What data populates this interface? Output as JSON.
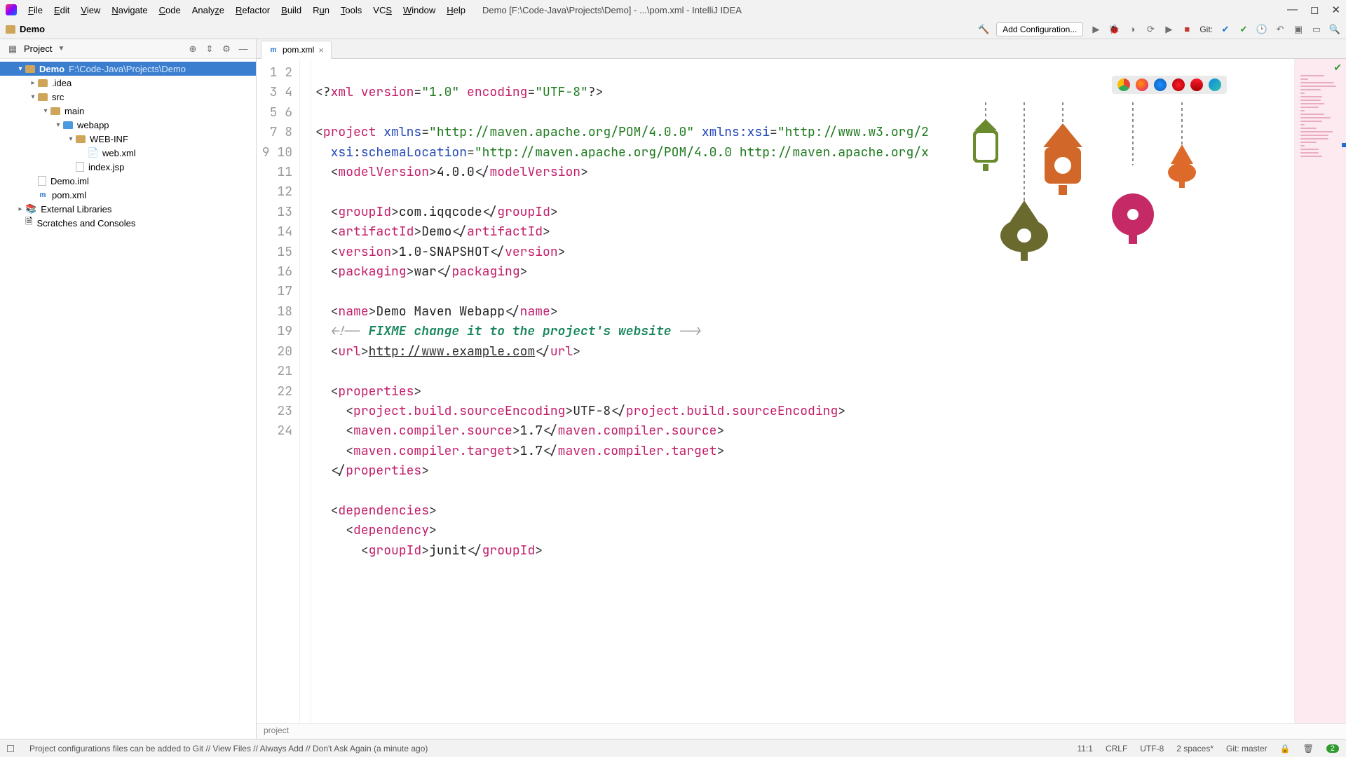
{
  "menubar": [
    "File",
    "Edit",
    "View",
    "Navigate",
    "Code",
    "Analyze",
    "Refactor",
    "Build",
    "Run",
    "Tools",
    "VCS",
    "Window",
    "Help"
  ],
  "window_title": "Demo [F:\\Code-Java\\Projects\\Demo] - ...\\pom.xml - IntelliJ IDEA",
  "navbar": {
    "project": "Demo",
    "add_config": "Add Configuration...",
    "git_label": "Git:"
  },
  "sidebar": {
    "title": "Project",
    "root": {
      "name": "Demo",
      "path": "F:\\Code-Java\\Projects\\Demo"
    },
    "nodes": {
      "idea": ".idea",
      "src": "src",
      "main": "main",
      "webapp": "webapp",
      "webinf": "WEB-INF",
      "webxml": "web.xml",
      "indexjsp": "index.jsp",
      "demoiml": "Demo.iml",
      "pom": "pom.xml",
      "ext": "External Libraries",
      "scr": "Scratches and Consoles"
    }
  },
  "tab": {
    "label": "pom.xml"
  },
  "gutter_lines": [
    "1",
    "2",
    "3",
    "4",
    "5",
    "6",
    "7",
    "8",
    "9",
    "10",
    "11",
    "12",
    "13",
    "14",
    "15",
    "16",
    "17",
    "18",
    "19",
    "20",
    "21",
    "22",
    "23",
    "24"
  ],
  "code": {
    "l1": {
      "a": "<?",
      "b": "xml version",
      "c": "=",
      "d": "\"1.0\"",
      "e": " encoding",
      "f": "=",
      "g": "\"UTF-8\"",
      "h": "?>"
    },
    "l3": {
      "a": "<",
      "b": "project",
      "c": " xmlns",
      "d": "=",
      "e": "\"http://maven.apache.org/POM/4.0.0\"",
      "f": " xmlns:xsi",
      "g": "=",
      "h": "\"http://www.w3.org/2"
    },
    "l4": {
      "a": "xsi",
      "b": ":",
      "c": "schemaLocation",
      "d": "=",
      "e": "\"http://maven.apache.org/POM/4.0.0 http://maven.apache.org/x"
    },
    "l5": {
      "a": "<",
      "b": "modelVersion",
      "c": ">",
      "d": "4.0.0",
      "e": "</",
      "f": "modelVersion",
      "g": ">"
    },
    "l7": {
      "a": "<",
      "b": "groupId",
      "c": ">",
      "d": "com.iqqcode",
      "e": "</",
      "f": "groupId",
      "g": ">"
    },
    "l8": {
      "a": "<",
      "b": "artifactId",
      "c": ">",
      "d": "Demo",
      "e": "</",
      "f": "artifactId",
      "g": ">"
    },
    "l9": {
      "a": "<",
      "b": "version",
      "c": ">",
      "d": "1.0-SNAPSHOT",
      "e": "</",
      "f": "version",
      "g": ">"
    },
    "l10": {
      "a": "<",
      "b": "packaging",
      "c": ">",
      "d": "war",
      "e": "</",
      "f": "packaging",
      "g": ">"
    },
    "l12": {
      "a": "<",
      "b": "name",
      "c": ">",
      "d": "Demo Maven Webapp",
      "e": "</",
      "f": "name",
      "g": ">"
    },
    "l13": {
      "a": "<!-- ",
      "b": "FIXME change it to the project's website",
      "c": " -->"
    },
    "l14": {
      "a": "<",
      "b": "url",
      "c": ">",
      "d": "http://www.example.com",
      "e": "</",
      "f": "url",
      "g": ">"
    },
    "l16": {
      "a": "<",
      "b": "properties",
      "c": ">"
    },
    "l17": {
      "a": "<",
      "b": "project.build.sourceEncoding",
      "c": ">",
      "d": "UTF-8",
      "e": "</",
      "f": "project.build.sourceEncoding",
      "g": ">"
    },
    "l18": {
      "a": "<",
      "b": "maven.compiler.source",
      "c": ">",
      "d": "1.7",
      "e": "</",
      "f": "maven.compiler.source",
      "g": ">"
    },
    "l19": {
      "a": "<",
      "b": "maven.compiler.target",
      "c": ">",
      "d": "1.7",
      "e": "</",
      "f": "maven.compiler.target",
      "g": ">"
    },
    "l20": {
      "a": "</",
      "b": "properties",
      "c": ">"
    },
    "l22": {
      "a": "<",
      "b": "dependencies",
      "c": ">"
    },
    "l23": {
      "a": "<",
      "b": "dependency",
      "c": ">"
    },
    "l24": {
      "a": "<",
      "b": "groupId",
      "c": ">",
      "d": "junit",
      "e": "</",
      "f": "groupId",
      "g": ">"
    }
  },
  "breadcrumb": "project",
  "status": {
    "msg": "Project configurations files can be added to Git // View Files // Always Add // Don't Ask Again (a minute ago)",
    "pos": "11:1",
    "eol": "CRLF",
    "enc": "UTF-8",
    "indent": "2 spaces*",
    "branch": "Git: master",
    "badge": "2"
  }
}
